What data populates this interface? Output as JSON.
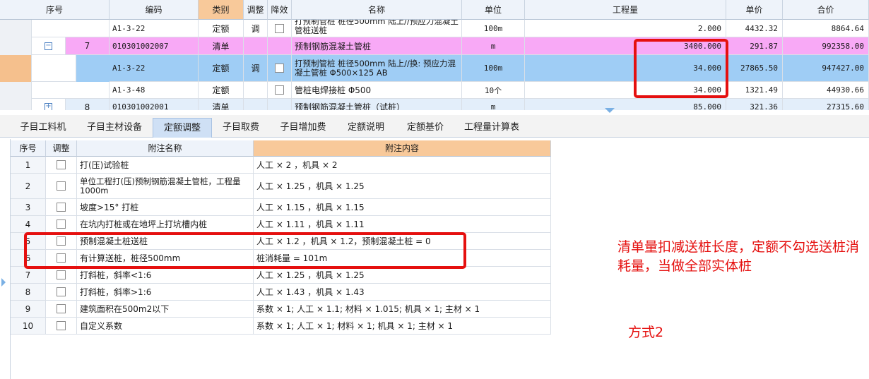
{
  "top_grid": {
    "headers": {
      "seq": "序号",
      "code": "编码",
      "category": "类别",
      "adjust": "调整",
      "reduce": "降效",
      "name": "名称",
      "unit": "单位",
      "quantity": "工程量",
      "unit_price": "单价",
      "total": "合价"
    },
    "rows": [
      {
        "seq": "",
        "code": "A1-3-22",
        "category": "定额",
        "adjust": "调",
        "name": "打预制管桩 桩径500mm 陆上//预应力混凝土管桩送桩",
        "unit": "100m",
        "quantity": "2.000",
        "unit_price": "4432.32",
        "total": "8864.64"
      },
      {
        "seq": "7",
        "code": "010301002007",
        "category": "清单",
        "adjust": "",
        "name": "预制钢筋混凝土管桩",
        "unit": "m",
        "quantity": "3400.000",
        "unit_price": "291.87",
        "total": "992358.00"
      },
      {
        "seq": "",
        "code": "A1-3-22",
        "category": "定额",
        "adjust": "调",
        "name": "打预制管桩 桩径500mm 陆上//换: 预应力混凝土管桩 Φ500×125 AB",
        "unit": "100m",
        "quantity": "34.000",
        "unit_price": "27865.50",
        "total": "947427.00"
      },
      {
        "seq": "",
        "code": "A1-3-48",
        "category": "定额",
        "adjust": "",
        "name": "管桩电焊接桩 Φ500",
        "unit": "10个",
        "quantity": "34.000",
        "unit_price": "1321.49",
        "total": "44930.66"
      },
      {
        "seq": "8",
        "code": "010301002001",
        "category": "清单",
        "adjust": "",
        "name": "预制钢筋混凝土管桩（试桩）",
        "unit": "m",
        "quantity": "85.000",
        "unit_price": "321.36",
        "total": "27315.60"
      }
    ]
  },
  "tabs": [
    {
      "label": "子目工料机"
    },
    {
      "label": "子目主材设备"
    },
    {
      "label": "定额调整"
    },
    {
      "label": "子目取费"
    },
    {
      "label": "子目增加费"
    },
    {
      "label": "定额说明"
    },
    {
      "label": "定额基价"
    },
    {
      "label": "工程量计算表"
    }
  ],
  "active_tab": "定额调整",
  "bottom_grid": {
    "headers": {
      "seq": "序号",
      "adjust": "调整",
      "note_name": "附注名称",
      "note_content": "附注内容"
    },
    "rows": [
      {
        "seq": "1",
        "name": "打(压)试验桩",
        "content": "人工 × 2 ，机具 × 2"
      },
      {
        "seq": "2",
        "name": "单位工程打(压)预制钢筋混凝土管桩，工程量1000m",
        "content": "人工 × 1.25 ，机具 × 1.25"
      },
      {
        "seq": "3",
        "name": "坡度>15° 打桩",
        "content": "人工 × 1.15 ，机具 × 1.15"
      },
      {
        "seq": "4",
        "name": "在坑内打桩或在地坪上打坑槽内桩",
        "content": "人工 × 1.11 ，机具 × 1.11"
      },
      {
        "seq": "5",
        "name": "预制混凝土桩送桩",
        "content": "人工 × 1.2 ，机具 × 1.2，预制混凝土桩 = 0"
      },
      {
        "seq": "6",
        "name": "有计算送桩，桩径500mm",
        "content": "桩消耗量 = 101m"
      },
      {
        "seq": "7",
        "name": "打斜桩，斜率<1:6",
        "content": "人工 × 1.25 ，机具 × 1.25"
      },
      {
        "seq": "8",
        "name": "打斜桩，斜率>1:6",
        "content": "人工 × 1.43 ，机具 × 1.43"
      },
      {
        "seq": "9",
        "name": "建筑面积在500m2以下",
        "content": "系数 × 1; 人工 × 1.1; 材料 × 1.015; 机具 × 1; 主材 × 1"
      },
      {
        "seq": "10",
        "name": "自定义系数",
        "content": "系数 × 1; 人工 × 1; 材料 × 1; 机具 × 1; 主材 × 1"
      }
    ]
  },
  "annotations": {
    "main_note": "清单量扣减送桩长度，定额不勾选送桩消耗量，当做全部实体桩",
    "method_label": "方式2"
  },
  "colors": {
    "highlight_pink": "#f8a9f6",
    "highlight_blue": "#9fcdf5",
    "annotation_red": "#e5100f",
    "header_orange": "#f8c99a"
  }
}
